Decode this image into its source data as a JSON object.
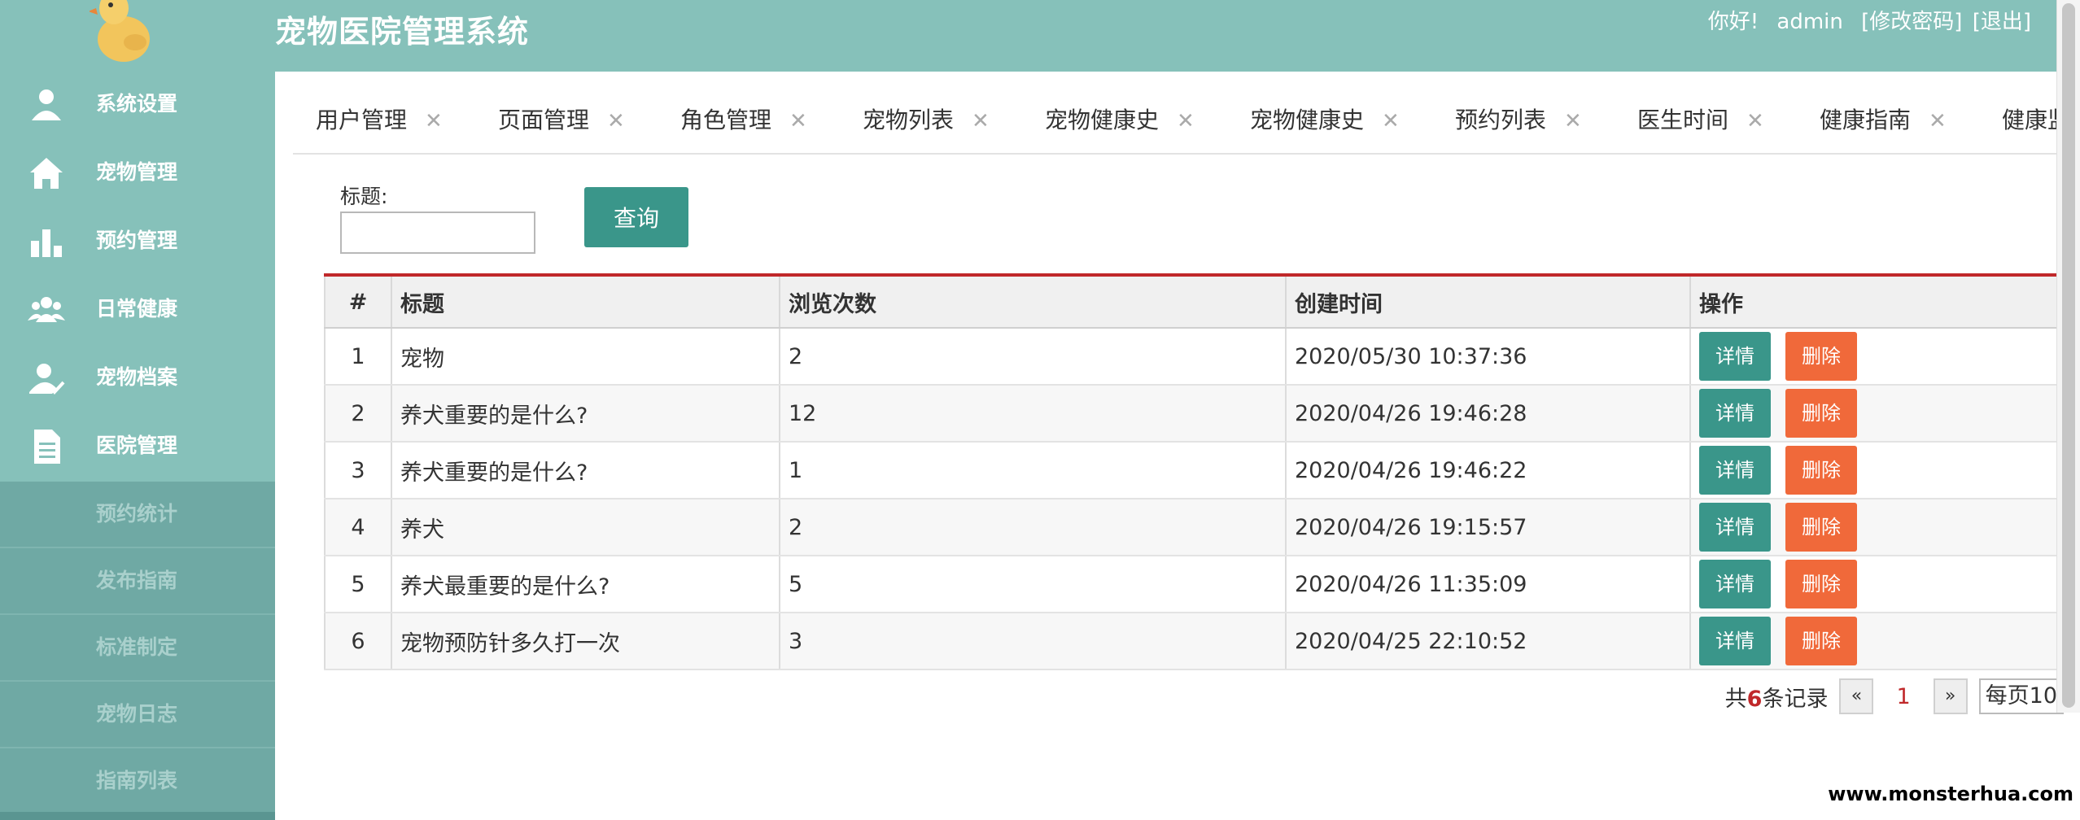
{
  "header": {
    "title": "宠物医院管理系统",
    "greeting": "你好!",
    "username": "admin",
    "change_password": "[修改密码]",
    "logout": "[退出]"
  },
  "sidebar": {
    "menu": [
      {
        "label": "系统设置",
        "icon": "user-settings-icon"
      },
      {
        "label": "宠物管理",
        "icon": "home-icon"
      },
      {
        "label": "预约管理",
        "icon": "bar-chart-icon"
      },
      {
        "label": "日常健康",
        "icon": "group-icon"
      },
      {
        "label": "宠物档案",
        "icon": "user-check-icon"
      },
      {
        "label": "医院管理",
        "icon": "document-icon"
      }
    ],
    "submenu": [
      {
        "label": "预约统计"
      },
      {
        "label": "发布指南"
      },
      {
        "label": "标准制定"
      },
      {
        "label": "宠物日志"
      },
      {
        "label": "指南列表"
      }
    ]
  },
  "tabs": [
    {
      "label": "用户管理"
    },
    {
      "label": "页面管理"
    },
    {
      "label": "角色管理"
    },
    {
      "label": "宠物列表"
    },
    {
      "label": "宠物健康史"
    },
    {
      "label": "宠物健康史"
    },
    {
      "label": "预约列表"
    },
    {
      "label": "医生时间"
    },
    {
      "label": "健康指南"
    },
    {
      "label": "健康监"
    }
  ],
  "search": {
    "label": "标题:",
    "value": "",
    "button": "查询"
  },
  "table": {
    "headers": [
      "#",
      "标题",
      "浏览次数",
      "创建时间",
      "操作"
    ],
    "rows": [
      {
        "idx": "1",
        "title": "宠物",
        "views": "2",
        "created": "2020/05/30 10:37:36"
      },
      {
        "idx": "2",
        "title": "养犬重要的是什么?",
        "views": "12",
        "created": "2020/04/26 19:46:28"
      },
      {
        "idx": "3",
        "title": "养犬重要的是什么?",
        "views": "1",
        "created": "2020/04/26 19:46:22"
      },
      {
        "idx": "4",
        "title": "养犬",
        "views": "2",
        "created": "2020/04/26 19:15:57"
      },
      {
        "idx": "5",
        "title": "养犬最重要的是什么?",
        "views": "5",
        "created": "2020/04/26 11:35:09"
      },
      {
        "idx": "6",
        "title": "宠物预防针多久打一次",
        "views": "3",
        "created": "2020/04/25 22:10:52"
      }
    ],
    "detail_label": "详情",
    "delete_label": "删除"
  },
  "pager": {
    "prefix": "共",
    "count": "6",
    "suffix": "条记录",
    "prev": "«",
    "current": "1",
    "next": "»",
    "page_size": "每页10"
  },
  "watermark": "www.monsterhua.com",
  "colors": {
    "sidebar": "#86c1ba",
    "submenu": "#6fa9a4",
    "primary_button": "#3a968a",
    "danger_button": "#f0693a",
    "accent_red": "#c0282a"
  }
}
